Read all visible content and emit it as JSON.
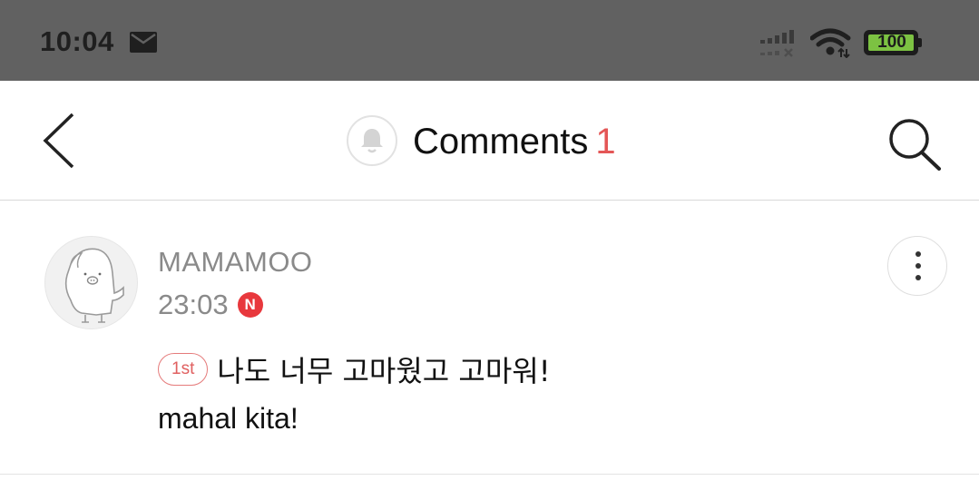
{
  "status_bar": {
    "time": "10:04",
    "battery_level": "100",
    "icons": [
      "mail-icon",
      "signal-icon",
      "wifi-icon",
      "battery-icon"
    ]
  },
  "header": {
    "title": "Comments",
    "count": "1",
    "icons": [
      "back-icon",
      "bell-icon",
      "search-icon"
    ]
  },
  "comment": {
    "author": "MAMAMOO",
    "time": "23:03",
    "new_badge": "N",
    "rank_badge": "1st",
    "text_line1": "나도 너무 고마웠고 고마워!",
    "text_line2": "mahal kita!"
  },
  "colors": {
    "status_bar_bg": "#616161",
    "accent_red": "#e45656",
    "new_badge": "#e8383d",
    "battery_green": "#7cc242",
    "muted_text": "#8a8a8a"
  }
}
